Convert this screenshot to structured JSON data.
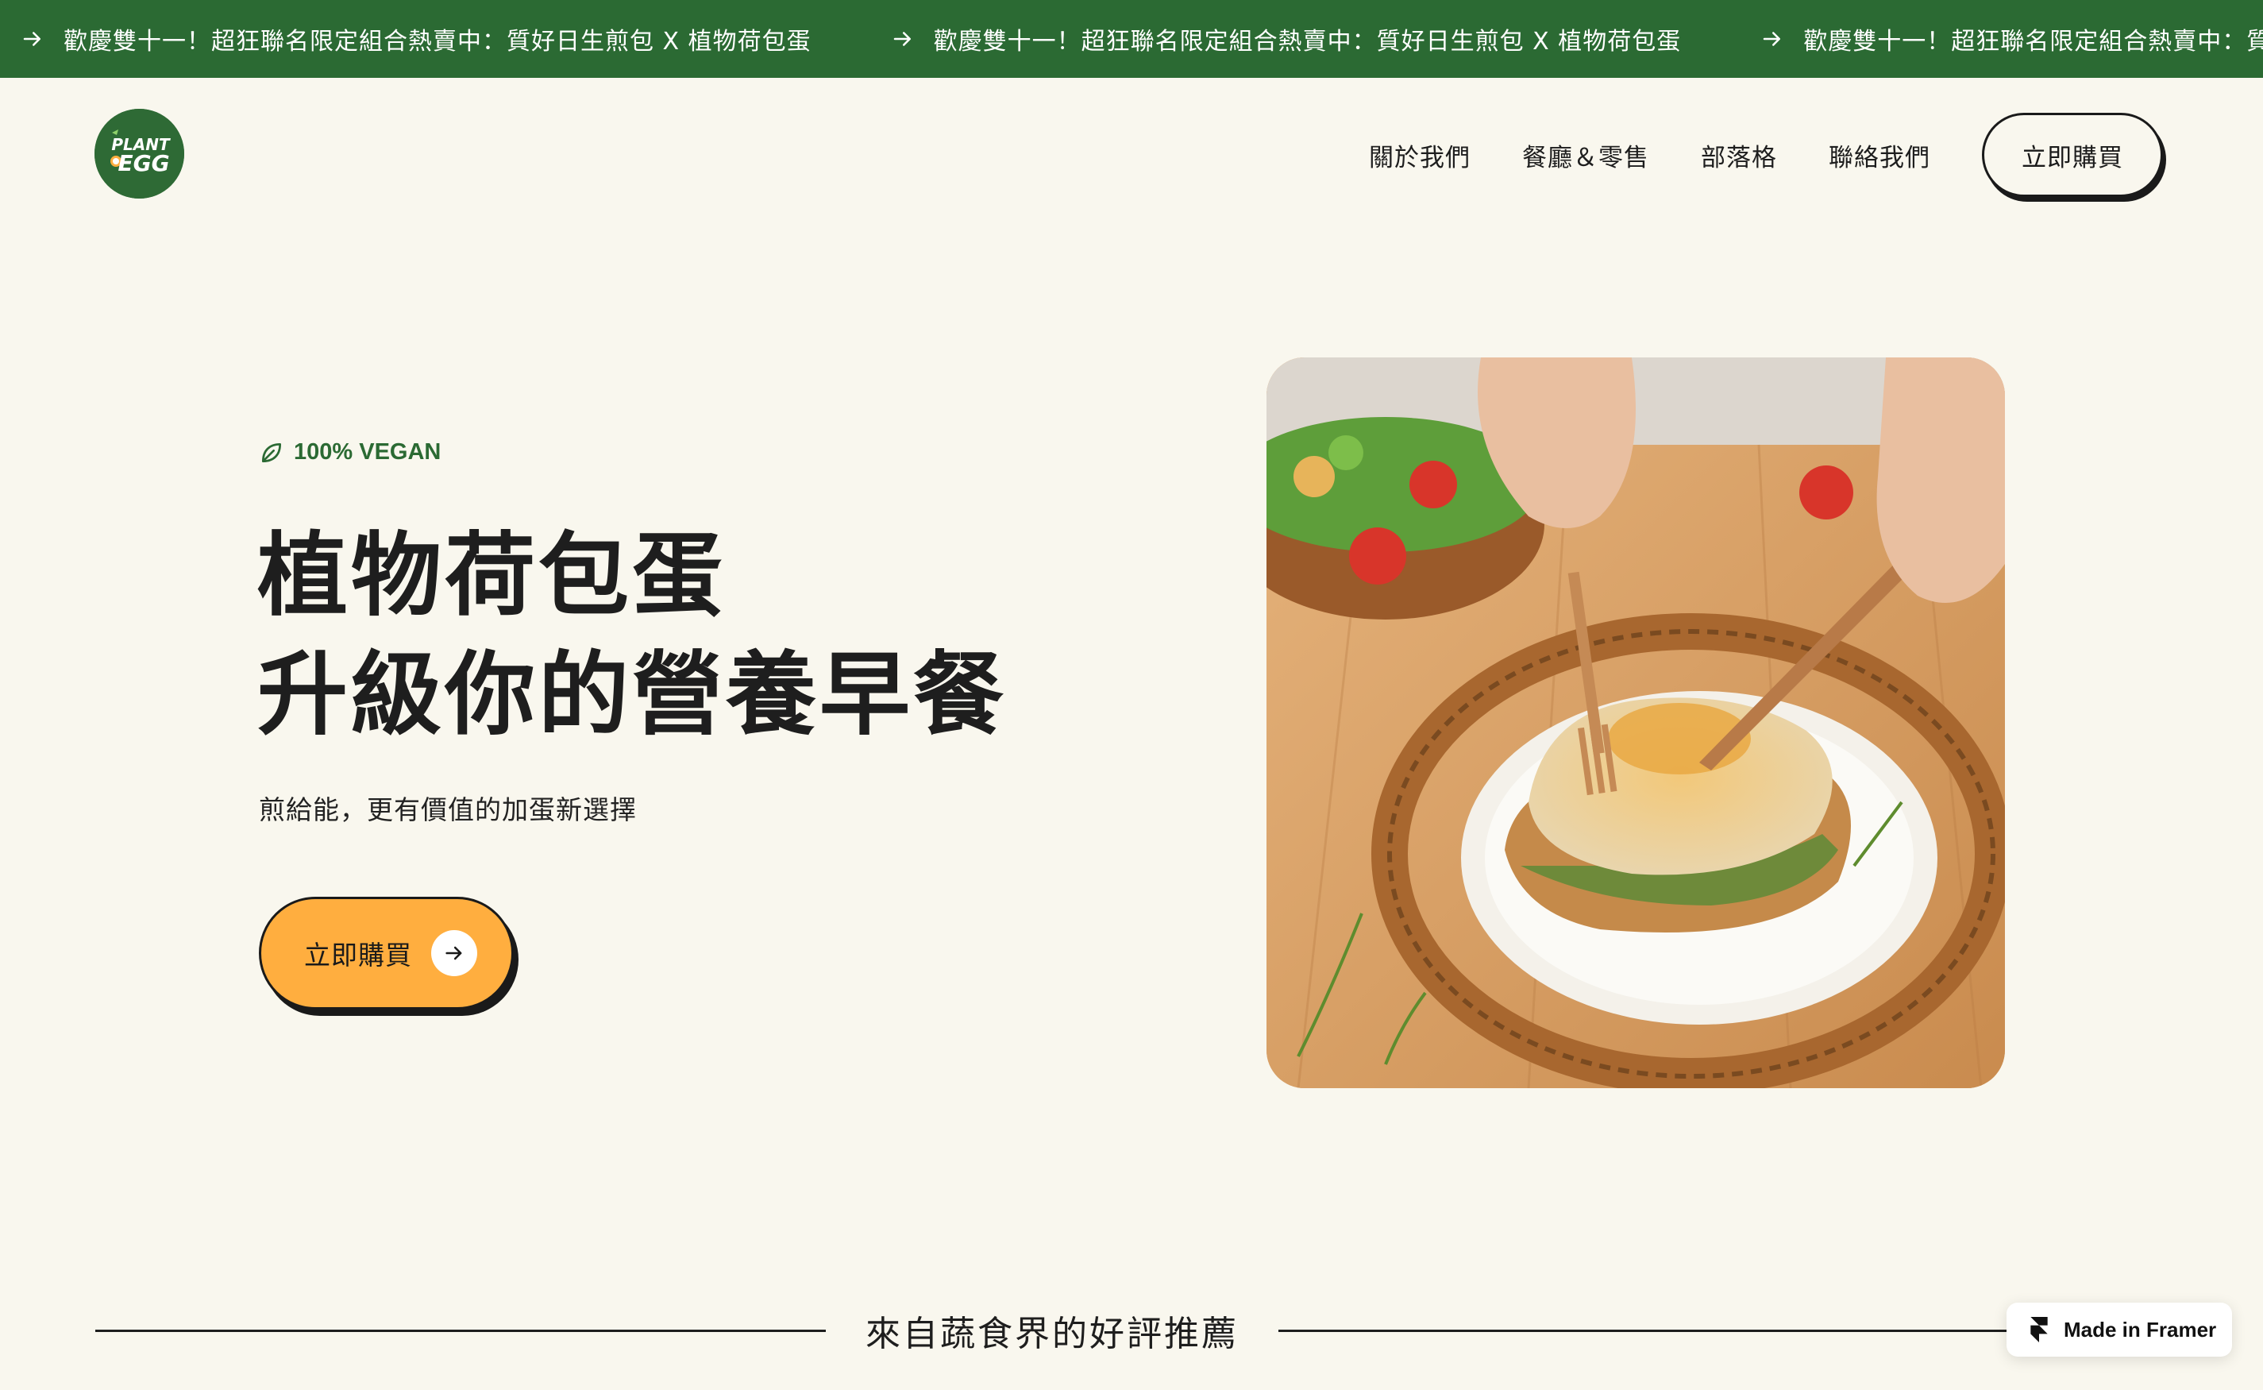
{
  "announcement": {
    "text": "歡慶雙十一！超狂聯名限定組合熱賣中：質好日生煎包 X 植物荷包蛋",
    "arrow_icon": "arrow-right-icon"
  },
  "header": {
    "logo_text_top": "PLANT",
    "logo_text_bottom": "EGG",
    "nav": [
      {
        "label": "關於我們"
      },
      {
        "label": "餐廳＆零售"
      },
      {
        "label": "部落格"
      },
      {
        "label": "聯絡我們"
      }
    ],
    "cta_label": "立即購買"
  },
  "hero": {
    "badge": "100% VEGAN",
    "badge_icon": "leaf-icon",
    "title_line1": "植物荷包蛋",
    "title_line2": "升級你的營養早餐",
    "subtitle": "煎給能，更有價值的加蛋新選擇",
    "cta_label": "立即購買",
    "cta_icon": "arrow-right-icon"
  },
  "section": {
    "heading": "來自蔬食界的好評推薦"
  },
  "framer_badge": {
    "label": "Made in Framer",
    "icon": "framer-icon"
  },
  "colors": {
    "background": "#F9F7EE",
    "brand_green": "#2B6A33",
    "accent_orange": "#FFAE3F",
    "text_dark": "#1E1E1E"
  }
}
